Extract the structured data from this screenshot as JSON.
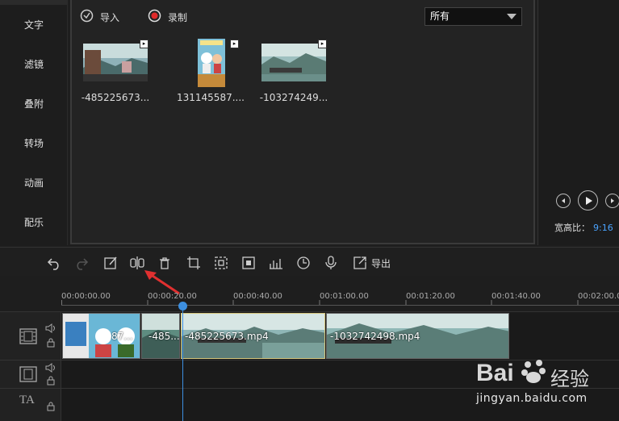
{
  "sidebar": {
    "items": [
      {
        "label": "文字"
      },
      {
        "label": "滤镜"
      },
      {
        "label": "叠附"
      },
      {
        "label": "转场"
      },
      {
        "label": "动画"
      },
      {
        "label": "配乐"
      }
    ]
  },
  "media": {
    "import_label": "导入",
    "record_label": "录制",
    "filter_selected": "所有",
    "items": [
      {
        "name": "-485225673...",
        "icon": "video-landscape"
      },
      {
        "name": "131145587....",
        "icon": "video-portrait"
      },
      {
        "name": "-103274249...",
        "icon": "video-landscape"
      }
    ]
  },
  "preview": {
    "ratio_label": "宽高比：",
    "ratio_value": "9:16"
  },
  "toolbar": {
    "export_label": "导出"
  },
  "timeline": {
    "ticks": [
      "00:00:00.00",
      "00:00:20.00",
      "00:00:40.00",
      "00:01:00.00",
      "00:01:20.00",
      "00:01:40.00",
      "00:02:00.0"
    ],
    "clips": [
      {
        "label": "87..."
      },
      {
        "label": "-485..."
      },
      {
        "label": "-485225673.mp4"
      },
      {
        "label": "-1032742498.mp4"
      }
    ],
    "text_track_icon": "TA"
  },
  "watermark": {
    "brand": "Bai",
    "brand_cn": "经验",
    "url": "jingyan.baidu.com"
  },
  "colors": {
    "accent": "#3d8fe0",
    "ratio_value": "#4aa3ff",
    "arrow": "#e03030",
    "record_dot": "#e02a2a"
  }
}
